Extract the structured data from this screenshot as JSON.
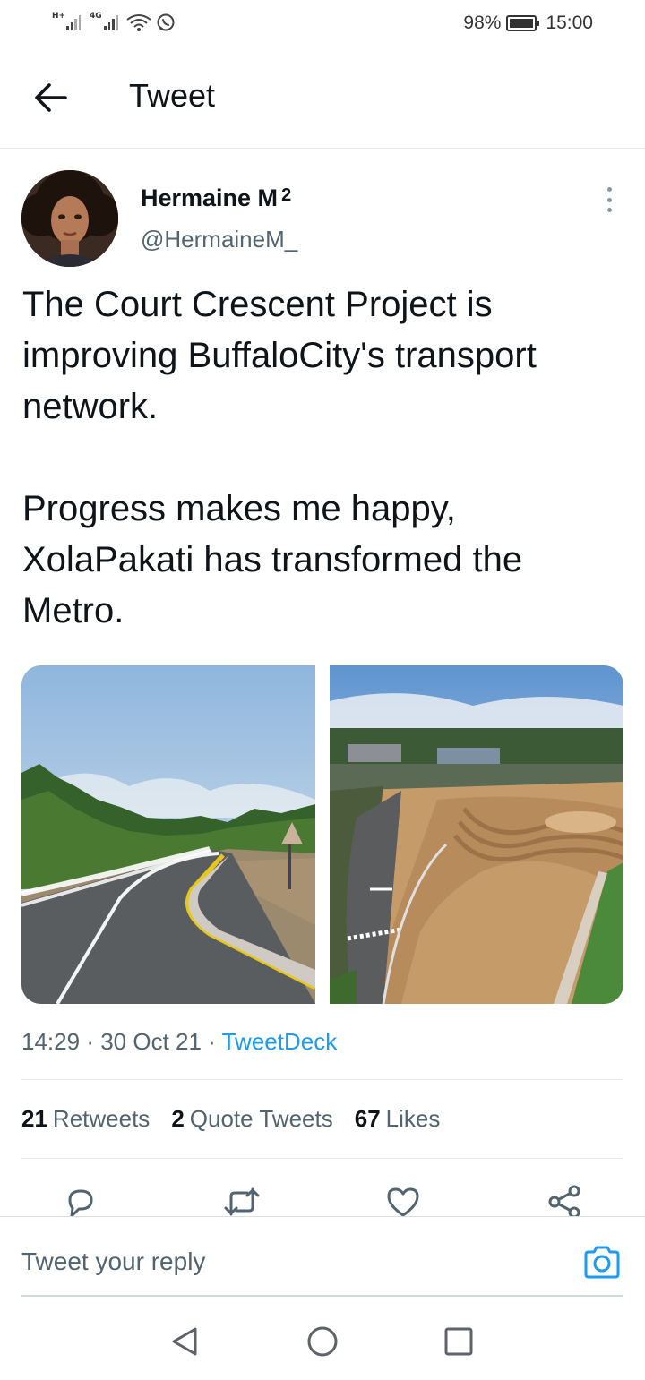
{
  "status_bar": {
    "signal1_tag": "H+",
    "signal2_tag": "4G",
    "battery_percent": "98%",
    "time": "15:00"
  },
  "header": {
    "title": "Tweet",
    "back_icon": "arrow-left-icon"
  },
  "tweet": {
    "author": {
      "name": "Hermaine M",
      "name_suffix": "2",
      "handle": "@HermaineM_"
    },
    "text": "The Court Crescent Project is improving BuffaloCity's transport network.\n\nProgress makes me happy, XolaPakati has transformed the Metro.",
    "time": "14:29",
    "date": "30 Oct 21",
    "source": "TweetDeck",
    "stats": {
      "retweets_count": "21",
      "retweets_label": "Retweets",
      "quotes_count": "2",
      "quotes_label": "Quote Tweets",
      "likes_count": "67",
      "likes_label": "Likes"
    }
  },
  "reply": {
    "placeholder": "Tweet your reply"
  },
  "colors": {
    "accent": "#1d9bf0",
    "text_primary": "#0f1419",
    "text_secondary": "#536471",
    "divider": "#e6ecf0"
  },
  "icons": [
    "arrow-left-icon",
    "more-vertical-icon",
    "reply-icon",
    "retweet-icon",
    "like-icon",
    "share-icon",
    "camera-icon",
    "nav-back-icon",
    "nav-home-icon",
    "nav-recents-icon"
  ]
}
